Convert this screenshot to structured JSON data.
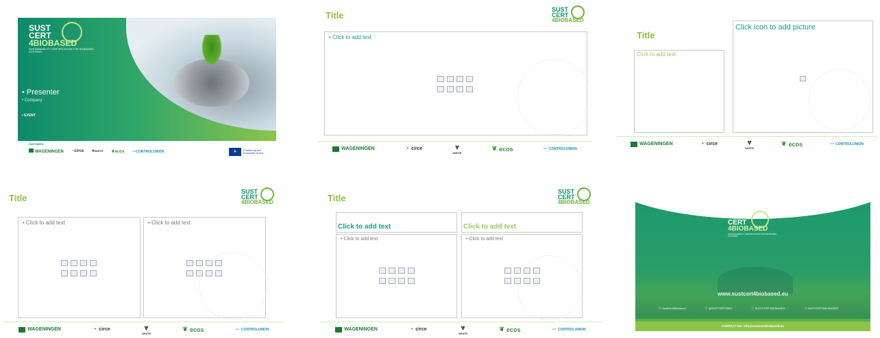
{
  "slide1": {
    "logo": {
      "line1": "SUST",
      "line2": "CERT",
      "line3": "4BIOBASED",
      "tagline": "SUSTAINABILITY CERTIFICATION FOR BIOBASED SYSTEMS"
    },
    "presenter": "• Presenter",
    "company": "• Company",
    "event": "• EVENT",
    "partners_label": "PARTNERS",
    "funded": "Funded by the European Union"
  },
  "slide2": {
    "title": "Title",
    "body": "• Click to add text"
  },
  "slide3": {
    "title": "Title",
    "left_body": "Click to add text",
    "picture": "Click icon to add picture"
  },
  "slide4": {
    "title": "Title",
    "left_body": "• Click to add text",
    "right_body": "• Click to add text"
  },
  "slide5": {
    "title": "Title",
    "left_heading": "Click to add text",
    "right_heading": "Click to add text",
    "left_body": "• Click to add text",
    "right_body": "• Click to add text"
  },
  "slide6": {
    "logo": {
      "line1": "SUST",
      "line2": "CERT",
      "line3": "4BIOBASED",
      "tagline": "SUSTAINABILITY CERTIFICATION FOR BIOBASED SYSTEMS"
    },
    "website": "www.sustcert4biobased.eu",
    "socials": [
      "SustCert4Biobased",
      "@SUSTCERT4BIO",
      "SUSTCERT4BIOBASED",
      "SUSTCERT4BIOBASED"
    ],
    "contact": "CONTACT US: info@sustcert4biobased.eu"
  },
  "partners": {
    "wageningen": "WAGENINGEN",
    "circe": "circe",
    "white": "WHITE",
    "ecos": "ecos",
    "control": "CONTROLUNION"
  },
  "colors": {
    "green": "#6cb43f",
    "teal": "#0f8e6d",
    "title": "#8cbf3f"
  }
}
